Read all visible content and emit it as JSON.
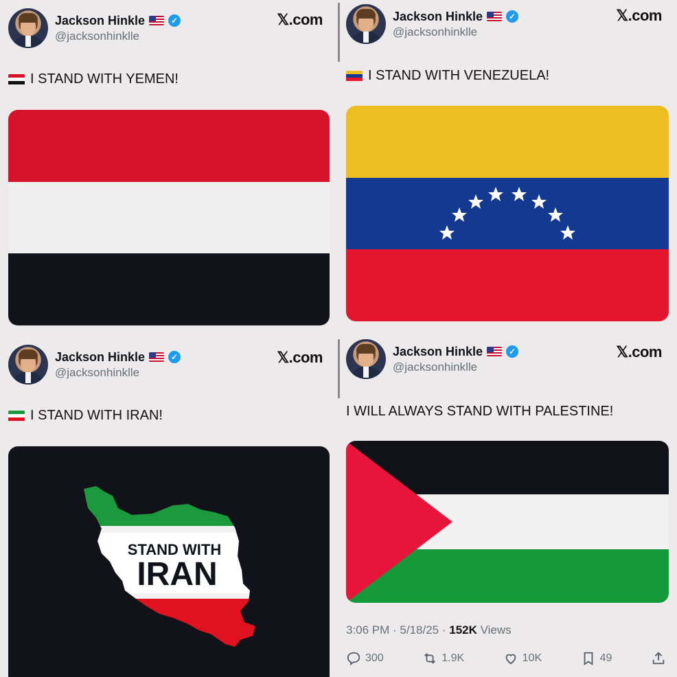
{
  "author": {
    "name": "Jackson Hinkle",
    "handle": "@jacksonhinklle"
  },
  "site_label": "𝕏.com",
  "tweets": [
    {
      "text": "I STAND WITH YEMEN!",
      "flag_icon": "yemen-flag-icon"
    },
    {
      "text": "I STAND WITH VENEZUELA!",
      "flag_icon": "venezuela-flag-icon"
    },
    {
      "text": "I STAND WITH IRAN!",
      "flag_icon": "iran-flag-icon",
      "media_text_top": "STAND WITH",
      "media_text_bottom": "IRAN"
    },
    {
      "text": "I WILL ALWAYS STAND WITH PALESTINE!",
      "timestamp": "3:06 PM · 5/18/25 · ",
      "views_count": "152K",
      "views_label": " Views",
      "replies": "300",
      "reposts": "1.9K",
      "likes": "10K",
      "bookmarks": "49"
    }
  ],
  "colors": {
    "yemen": [
      "#d7132b",
      "#f1f1f1",
      "#12121a"
    ],
    "venezuela": [
      "#ecbe22",
      "#133990",
      "#e4162e"
    ],
    "palestine": [
      "#111118",
      "#f1f1f1",
      "#159a3a",
      "#e8143a"
    ],
    "iran_map": [
      "#1a9a3c",
      "#ffffff",
      "#e0121f"
    ],
    "verified": "#1d9bf0"
  }
}
